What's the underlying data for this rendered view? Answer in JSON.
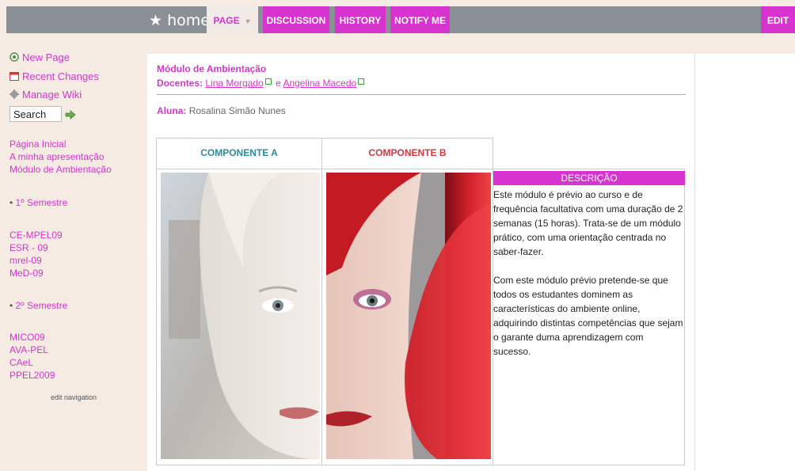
{
  "topnav": {
    "home": "home",
    "tabs": [
      {
        "label": "PAGE",
        "key": "page"
      },
      {
        "label": "DISCUSSION",
        "key": "discussion"
      },
      {
        "label": "HISTORY",
        "key": "history"
      },
      {
        "label": "NOTIFY ME",
        "key": "notify"
      }
    ],
    "edit": "EDIT"
  },
  "sidebar": {
    "tools": [
      {
        "label": "New Page",
        "icon": "new-page-icon"
      },
      {
        "label": "Recent Changes",
        "icon": "calendar-icon"
      },
      {
        "label": "Manage Wiki",
        "icon": "gear-icon"
      }
    ],
    "search_value": "Search",
    "nav": {
      "links1": [
        "Página Inicial",
        "A minha apresentação",
        "Módulo de Ambientação"
      ],
      "sem1": "1º Semestre",
      "links2": [
        "CE-MPEL09",
        "ESR - 09",
        "mrel-09",
        "MeD-09"
      ],
      "sem2": "2º Semestre",
      "links3": [
        "MICO09",
        "AVA-PEL",
        "CAeL",
        "PPEL2009"
      ]
    },
    "edit_navigation": "edit navigation"
  },
  "content": {
    "title": "Módulo de Ambientação",
    "docentes_label": "Docentes:",
    "docente1": "Lina Morgado",
    "connector": "e",
    "docente2": "Angelina Macedo",
    "aluna_label": "Aluna:",
    "aluna_name": "Rosalina Simão Nunes",
    "comp_a": "COMPONENTE A",
    "comp_b": "COMPONENTE B",
    "desc_title": "DESCRIÇÃO",
    "desc_p1": "Este módulo é prévio ao curso e de frequência facultativa com uma duração de 2 semanas (15 horas). Trata-se de um módulo prático, com uma orientação centrada no saber-fazer.",
    "desc_p2": "Com este módulo prévio pretende-se que todos os estudantes dominem as características do ambiente online, adquirindo distintas competências que sejam o garante duma aprendizagem com sucesso."
  },
  "colors": {
    "accent": "#d633cf",
    "topbar": "#8b8f96",
    "comp_a": "#2a8b9b",
    "comp_b": "#d8353f"
  }
}
